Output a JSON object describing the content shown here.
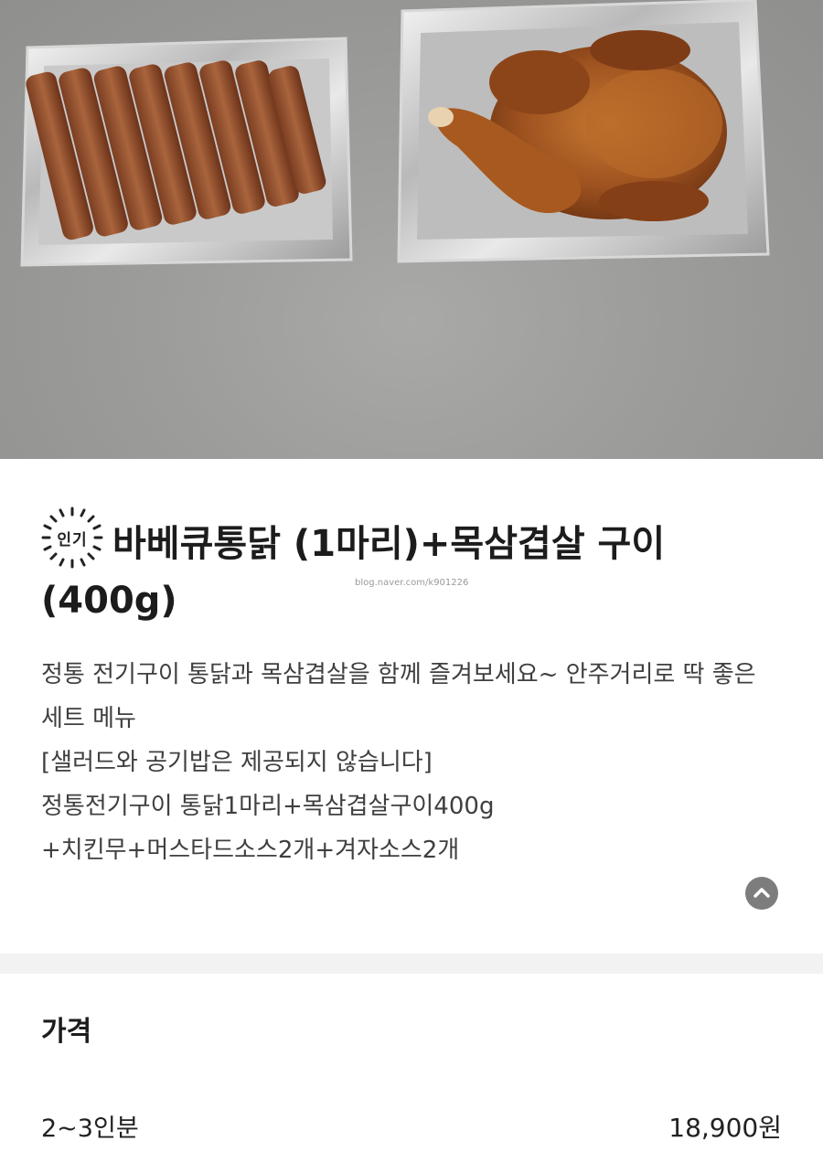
{
  "menu_item": {
    "badge": "인기",
    "title_line1": "바베큐통닭 (1마리)+목삼겹살 구이",
    "title_line2": "(400g)",
    "watermark": "blog.naver.com/k901226",
    "description_lines": [
      "정통 전기구이 통닭과 목삼겹살을 함께 즐겨보세요~ 안주거리로 딱 좋은",
      "세트 메뉴",
      "[샐러드와 공기밥은 제공되지 않습니다]",
      "정통전기구이 통닭1마리+목삼겹살구이400g",
      "+치킨무+머스타드소스2개+겨자소스2개"
    ]
  },
  "price_section": {
    "heading": "가격",
    "rows": [
      {
        "serving": "2~3인분",
        "price": "18,900원"
      }
    ]
  },
  "icons": {
    "scroll_top": "chevron-up-icon",
    "badge": "sunburst-badge-icon"
  },
  "colors": {
    "background": "#ffffff",
    "divider": "#f2f2f2",
    "scroll_button": "#7d7d7d",
    "description_text": "#3f3f3f"
  }
}
